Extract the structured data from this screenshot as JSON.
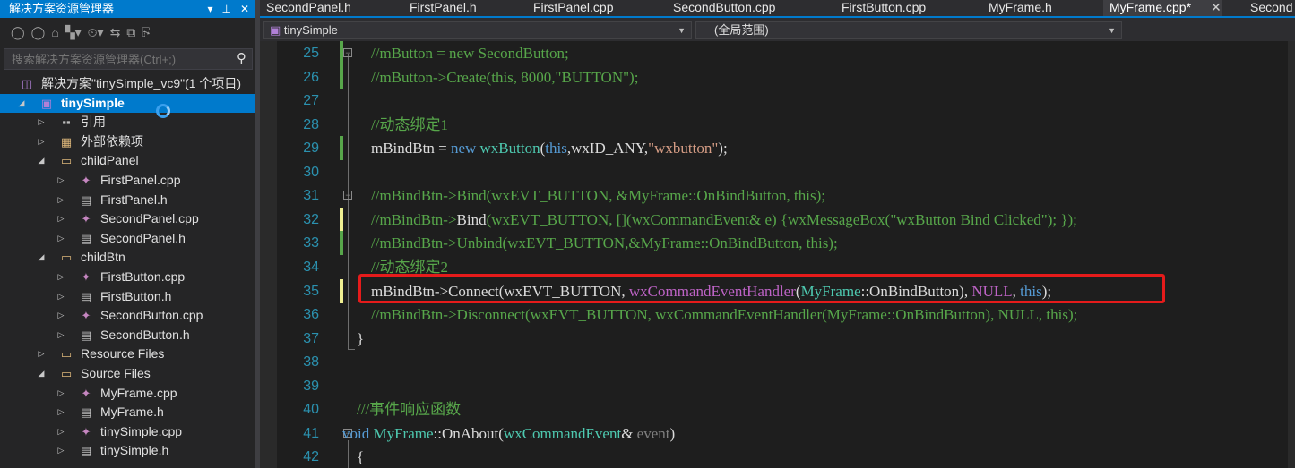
{
  "explorer": {
    "title": "解决方案资源管理器",
    "title_buttons": [
      "▾",
      "⊞",
      "✕"
    ],
    "search_placeholder": "搜索解决方案资源管理器(Ctrl+;)",
    "toolbar_icons": [
      "back-icon",
      "forward-icon",
      "home-icon",
      "switch-views-icon",
      "pending-changes-icon",
      "sync-icon",
      "collapse-all-icon",
      "show-all-files-icon"
    ],
    "tree": [
      {
        "label": "解决方案\"tinySimple_vc9\"(1 个项目)",
        "icon": "solution-icon",
        "glyph": "◫",
        "cls": "ico-sln",
        "level": 0,
        "expander": "",
        "selected": false
      },
      {
        "label": "tinySimple",
        "icon": "project-icon",
        "glyph": "▣",
        "cls": "ico-proj",
        "level": 0,
        "expander": "◢",
        "selected": true
      },
      {
        "label": "引用",
        "icon": "references-icon",
        "glyph": "▪▪",
        "cls": "ico-ref",
        "level": 1,
        "expander": "▷",
        "selected": false
      },
      {
        "label": "外部依赖项",
        "icon": "external-dependencies-icon",
        "glyph": "▦",
        "cls": "ico-ext",
        "level": 1,
        "expander": "▷",
        "selected": false
      },
      {
        "label": "childPanel",
        "icon": "filter-folder-icon",
        "glyph": "▭",
        "cls": "ico-folder",
        "level": 1,
        "expander": "◢",
        "selected": false
      },
      {
        "label": "FirstPanel.cpp",
        "icon": "cpp-file-icon",
        "glyph": "✦",
        "cls": "ico-cpp",
        "level": 2,
        "expander": "▷",
        "selected": false
      },
      {
        "label": "FirstPanel.h",
        "icon": "header-file-icon",
        "glyph": "▤",
        "cls": "ico-h",
        "level": 2,
        "expander": "▷",
        "selected": false
      },
      {
        "label": "SecondPanel.cpp",
        "icon": "cpp-file-icon",
        "glyph": "✦",
        "cls": "ico-cpp",
        "level": 2,
        "expander": "▷",
        "selected": false
      },
      {
        "label": "SecondPanel.h",
        "icon": "header-file-icon",
        "glyph": "▤",
        "cls": "ico-h",
        "level": 2,
        "expander": "▷",
        "selected": false
      },
      {
        "label": "childBtn",
        "icon": "filter-folder-icon",
        "glyph": "▭",
        "cls": "ico-folder",
        "level": 1,
        "expander": "◢",
        "selected": false
      },
      {
        "label": "FirstButton.cpp",
        "icon": "cpp-file-icon",
        "glyph": "✦",
        "cls": "ico-cpp",
        "level": 2,
        "expander": "▷",
        "selected": false
      },
      {
        "label": "FirstButton.h",
        "icon": "header-file-icon",
        "glyph": "▤",
        "cls": "ico-h",
        "level": 2,
        "expander": "▷",
        "selected": false
      },
      {
        "label": "SecondButton.cpp",
        "icon": "cpp-file-icon",
        "glyph": "✦",
        "cls": "ico-cpp",
        "level": 2,
        "expander": "▷",
        "selected": false
      },
      {
        "label": "SecondButton.h",
        "icon": "header-file-icon",
        "glyph": "▤",
        "cls": "ico-h",
        "level": 2,
        "expander": "▷",
        "selected": false
      },
      {
        "label": "Resource Files",
        "icon": "filter-folder-icon",
        "glyph": "▭",
        "cls": "ico-folder",
        "level": 1,
        "expander": "▷",
        "selected": false
      },
      {
        "label": "Source Files",
        "icon": "filter-folder-icon",
        "glyph": "▭",
        "cls": "ico-folder",
        "level": 1,
        "expander": "◢",
        "selected": false
      },
      {
        "label": "MyFrame.cpp",
        "icon": "cpp-file-icon",
        "glyph": "✦",
        "cls": "ico-cpp",
        "level": 2,
        "expander": "▷",
        "selected": false
      },
      {
        "label": "MyFrame.h",
        "icon": "header-file-icon",
        "glyph": "▤",
        "cls": "ico-h",
        "level": 2,
        "expander": "▷",
        "selected": false
      },
      {
        "label": "tinySimple.cpp",
        "icon": "cpp-file-icon",
        "glyph": "✦",
        "cls": "ico-cpp",
        "level": 2,
        "expander": "▷",
        "selected": false
      },
      {
        "label": "tinySimple.h",
        "icon": "header-file-icon",
        "glyph": "▤",
        "cls": "ico-h",
        "level": 2,
        "expander": "▷",
        "selected": false
      }
    ]
  },
  "tabs": [
    {
      "label": "SecondPanel.h",
      "active": false
    },
    {
      "label": "FirstPanel.h",
      "active": false
    },
    {
      "label": "FirstPanel.cpp",
      "active": false
    },
    {
      "label": "SecondButton.cpp",
      "active": false
    },
    {
      "label": "FirstButton.cpp",
      "active": false
    },
    {
      "label": "MyFrame.h",
      "active": false
    },
    {
      "label": "MyFrame.cpp*",
      "active": true,
      "close": "✕"
    },
    {
      "label": "Second",
      "active": false
    }
  ],
  "nav": {
    "project": "tinySimple",
    "scope": "(全局范围)"
  },
  "colors": {
    "accent": "#007acc",
    "comment": "#57a64a",
    "keyword": "#569cd6",
    "type": "#4ec9b0",
    "string": "#d69d85",
    "macro": "#bd63c5",
    "highlight_box": "#e51b1b"
  },
  "code_lines": [
    {
      "n": "25",
      "change": "saved",
      "fold": "⊟",
      "indent": 1,
      "tokens": [
        [
          "cm",
          "//mButton = new SecondButton;"
        ]
      ]
    },
    {
      "n": "26",
      "change": "saved",
      "indent": 1,
      "tokens": [
        [
          "cm",
          "//mButton->Create(this, 8000,\"BUTTON\");"
        ]
      ]
    },
    {
      "n": "27",
      "change": "",
      "indent": 1,
      "tokens": []
    },
    {
      "n": "28",
      "change": "",
      "indent": 1,
      "tokens": [
        [
          "cm",
          "//动态绑定1"
        ]
      ]
    },
    {
      "n": "29",
      "change": "saved",
      "indent": 1,
      "tokens": [
        [
          "tx",
          "mBindBtn = "
        ],
        [
          "kw",
          "new "
        ],
        [
          "ty",
          "wxButton"
        ],
        [
          "tx",
          "("
        ],
        [
          "kw",
          "this"
        ],
        [
          "tx",
          ",wxID_ANY,"
        ],
        [
          "st",
          "\"wxbutton\""
        ],
        [
          "tx",
          ");"
        ]
      ]
    },
    {
      "n": "30",
      "change": "",
      "indent": 1,
      "tokens": []
    },
    {
      "n": "31",
      "change": "",
      "fold": "⊟",
      "indent": 1,
      "tokens": [
        [
          "cm",
          "//mBindBtn->Bind(wxEVT_BUTTON, &MyFrame::OnBindButton, this);"
        ]
      ]
    },
    {
      "n": "32",
      "change": "unsaved",
      "indent": 1,
      "tokens": [
        [
          "cm",
          "//mBindBtn->"
        ],
        [
          "tx",
          "Bind"
        ],
        [
          "cm",
          "(wxEVT_BUTTON, [](wxCommandEvent& e) {wxMessageBox(\"wxButton Bind Clicked\"); });"
        ]
      ]
    },
    {
      "n": "33",
      "change": "saved",
      "indent": 1,
      "tokens": [
        [
          "cm",
          "//mBindBtn->Unbind(wxEVT_BUTTON,&MyFrame::OnBindButton, this);"
        ]
      ]
    },
    {
      "n": "34",
      "change": "",
      "indent": 1,
      "tokens": [
        [
          "cm",
          "//动态绑定2"
        ]
      ]
    },
    {
      "n": "35",
      "change": "unsaved",
      "indent": 1,
      "tokens": [
        [
          "tx",
          "mBindBtn->Connect(wxEVT_BUTTON, "
        ],
        [
          "mc",
          "wxCommandEventHandler"
        ],
        [
          "tx",
          "("
        ],
        [
          "cl",
          "MyFrame"
        ],
        [
          "tx",
          "::OnBindButton), "
        ],
        [
          "mc",
          "NULL"
        ],
        [
          "tx",
          ", "
        ],
        [
          "kw",
          "this"
        ],
        [
          "tx",
          ");"
        ]
      ]
    },
    {
      "n": "36",
      "change": "",
      "indent": 1,
      "tokens": [
        [
          "cm",
          "//mBindBtn->Disconnect(wxEVT_BUTTON, wxCommandEventHandler(MyFrame::OnBindButton), NULL, this);"
        ]
      ]
    },
    {
      "n": "37",
      "change": "",
      "indent": 0,
      "tokens": [
        [
          "tx",
          "}"
        ]
      ]
    },
    {
      "n": "38",
      "change": "",
      "indent": 0,
      "tokens": []
    },
    {
      "n": "39",
      "change": "",
      "indent": 0,
      "tokens": []
    },
    {
      "n": "40",
      "change": "",
      "indent": 0,
      "tokens": [
        [
          "cm",
          "///事件响应函数"
        ]
      ]
    },
    {
      "n": "41",
      "change": "",
      "fold": "⊟",
      "indent": -1,
      "tokens": [
        [
          "kw",
          "void "
        ],
        [
          "cl",
          "MyFrame"
        ],
        [
          "tx",
          "::OnAbout("
        ],
        [
          "ty",
          "wxCommandEvent"
        ],
        [
          "tx",
          "& "
        ],
        [
          "pr",
          "event"
        ],
        [
          "tx",
          ")"
        ]
      ]
    },
    {
      "n": "42",
      "change": "",
      "indent": 0,
      "tokens": [
        [
          "tx",
          "{"
        ]
      ]
    }
  ]
}
